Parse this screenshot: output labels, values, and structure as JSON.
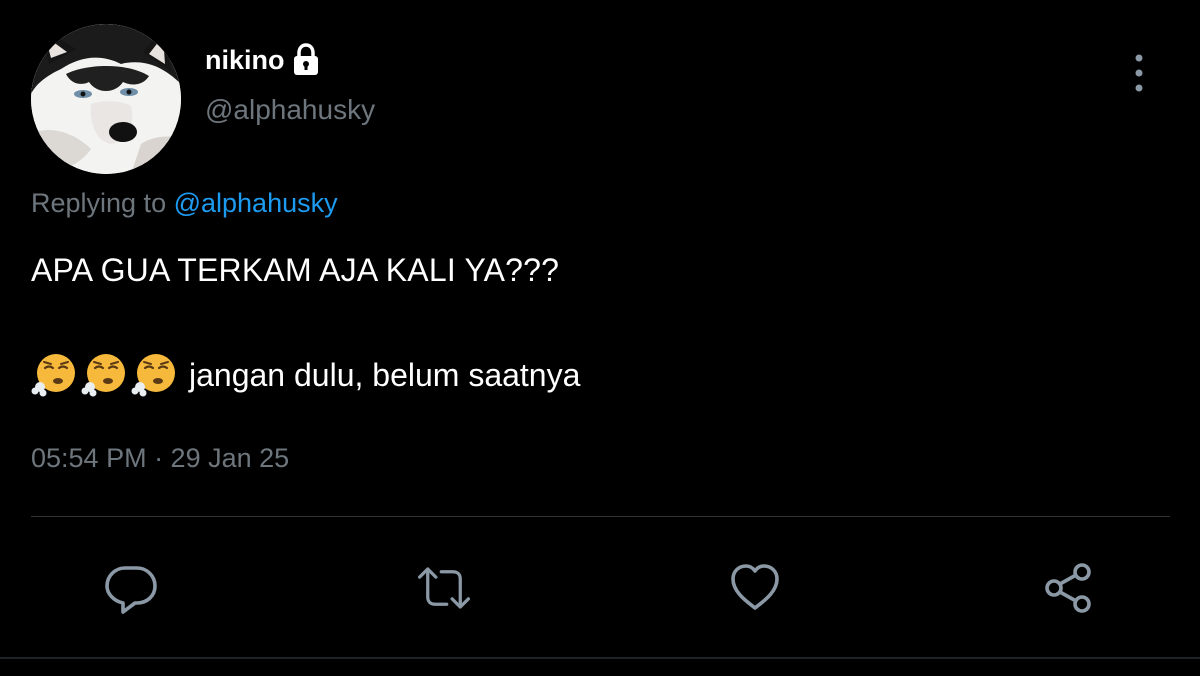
{
  "author": {
    "display_name": "nikino",
    "handle": "@alphahusky",
    "protected_icon": "lock-icon",
    "avatar_icon": "husky-avatar"
  },
  "reply": {
    "prefix": "Replying to ",
    "mention": "@alphahusky"
  },
  "body": {
    "line1": "APA GUA TERKAM AJA KALI YA???",
    "emojis": [
      "face-exhaling",
      "face-exhaling",
      "face-exhaling"
    ],
    "line2": "jangan dulu, belum saatnya"
  },
  "meta": {
    "timestamp": "05:54 PM · 29 Jan 25"
  },
  "actions": {
    "reply_icon": "comment-icon",
    "retweet_icon": "retweet-icon",
    "like_icon": "heart-icon",
    "share_icon": "share-icon",
    "more_icon": "more-vertical-icon"
  },
  "colors": {
    "background": "#000000",
    "text": "#ffffff",
    "muted": "#6e767d",
    "link": "#1d9bf0",
    "divider": "#2f3336"
  }
}
